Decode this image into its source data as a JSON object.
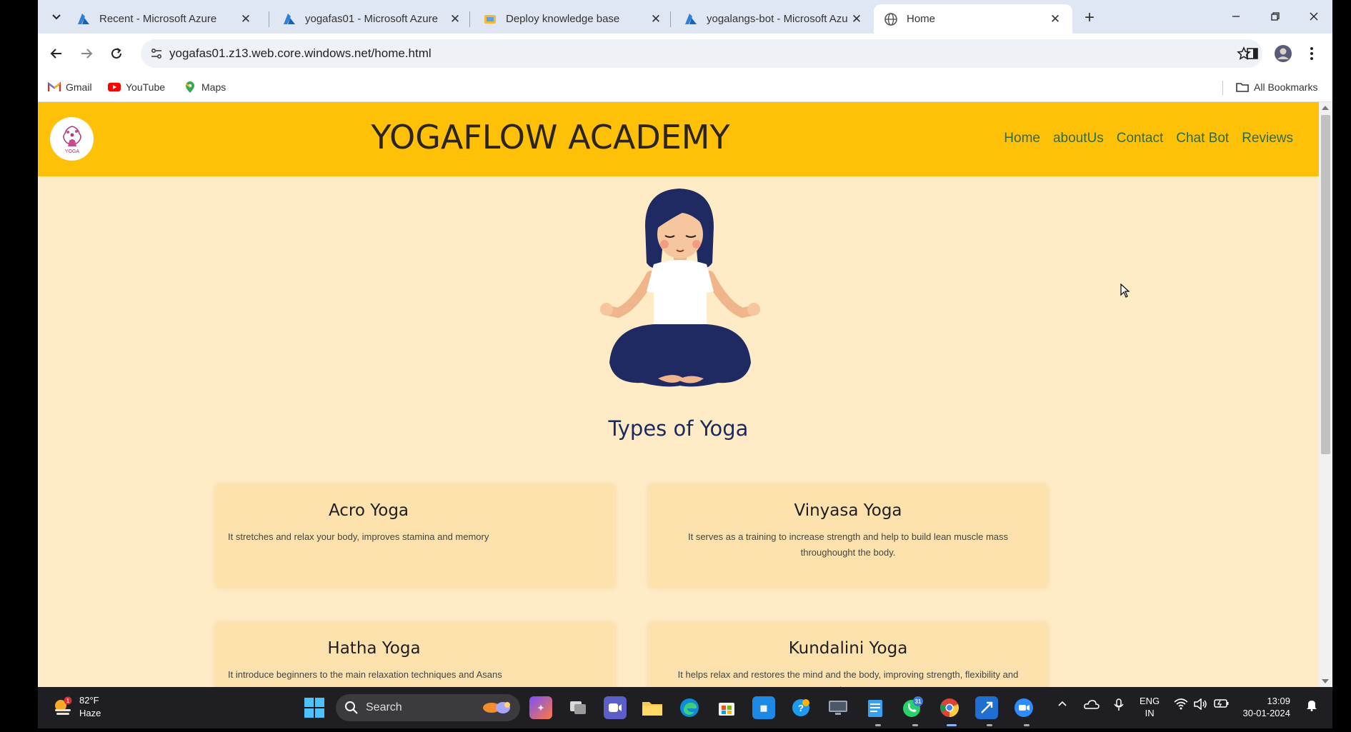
{
  "browser": {
    "tabs": [
      {
        "label": "Recent - Microsoft Azure",
        "icon": "azure-icon",
        "active": false
      },
      {
        "label": "yogafas01 - Microsoft Azure",
        "icon": "azure-icon",
        "active": false
      },
      {
        "label": "Deploy knowledge base",
        "icon": "language-studio-icon",
        "active": false
      },
      {
        "label": "yogalangs-bot - Microsoft Azu",
        "icon": "azure-icon",
        "active": false
      },
      {
        "label": "Home",
        "icon": "globe-icon",
        "active": true
      }
    ],
    "url": "yogafas01.z13.web.core.windows.net/home.html",
    "bookmarks": [
      {
        "label": "Gmail",
        "icon": "gmail-icon"
      },
      {
        "label": "YouTube",
        "icon": "youtube-icon"
      },
      {
        "label": "Maps",
        "icon": "maps-icon"
      }
    ],
    "all_bookmarks_label": "All Bookmarks"
  },
  "site": {
    "title": "YOGAFLOW ACADEMY",
    "logo_text": "YOGA",
    "nav": [
      "Home",
      "aboutUs",
      "Contact",
      "Chat Bot",
      "Reviews"
    ],
    "section_heading": "Types of Yoga",
    "cards": [
      {
        "title": "Acro Yoga",
        "description": "It stretches and relax your body, improves stamina and memory"
      },
      {
        "title": "Vinyasa Yoga",
        "description": "It serves as a training to increase strength and help to build lean muscle mass throughought the body."
      },
      {
        "title": "Hatha Yoga",
        "description": "It introduce beginners to the main relaxation techniques and Asans"
      },
      {
        "title": "Kundalini Yoga",
        "description": "It helps relax and restores the mind and the body, improving strength, flexibility and endurance"
      }
    ],
    "colors": {
      "header": "#ffc107",
      "background": "#ffebc6",
      "card": "#fee2ad",
      "nav_link": "#2f6b3d",
      "heading": "#1b2a5e"
    }
  },
  "taskbar": {
    "weather": {
      "temp": "82°F",
      "condition": "Haze",
      "badge": "1"
    },
    "search_placeholder": "Search",
    "whatsapp_badge": "31",
    "language": {
      "line1": "ENG",
      "line2": "IN"
    },
    "clock": {
      "time": "13:09",
      "date": "30-01-2024"
    }
  }
}
